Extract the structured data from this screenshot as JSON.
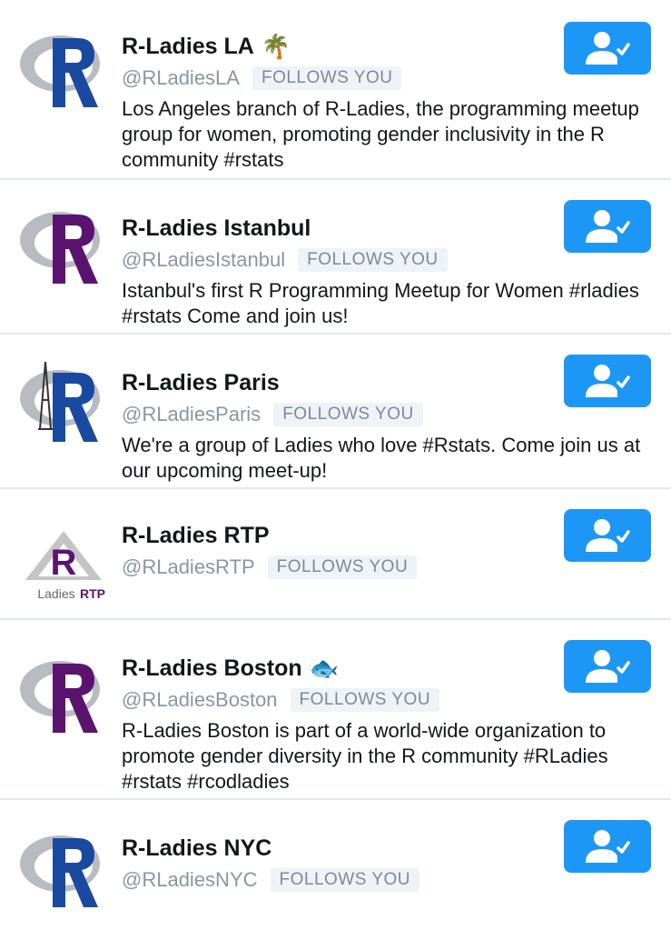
{
  "accounts": [
    {
      "name": "R-Ladies LA",
      "emoji": "🌴",
      "handle": "@RLadiesLA",
      "badge": "FOLLOWS YOU",
      "bio": "Los Angeles branch of R-Ladies, the programming meetup group for women, promoting gender inclusivity in the R community #rstats",
      "avatar_color": "#1a4aa0"
    },
    {
      "name": "R-Ladies Istanbul",
      "emoji": "",
      "handle": "@RLadiesIstanbul",
      "badge": "FOLLOWS YOU",
      "bio": "Istanbul's first R Programming Meetup for Women #rladies #rstats Come and join us!",
      "avatar_color": "#5a1470"
    },
    {
      "name": "R-Ladies Paris",
      "emoji": "",
      "handle": "@RLadiesParis",
      "badge": "FOLLOWS YOU",
      "bio": "We're a group of Ladies who love #Rstats. Come join us at our upcoming meet-up!",
      "avatar_color": "#1a4aa0"
    },
    {
      "name": "R-Ladies RTP",
      "emoji": "",
      "handle": "@RLadiesRTP",
      "badge": "FOLLOWS YOU",
      "bio": "",
      "avatar_color": "#5a1470",
      "avatar_text": "Ladies RTP"
    },
    {
      "name": "R-Ladies Boston",
      "emoji": "🐟",
      "handle": "@RLadiesBoston",
      "badge": "FOLLOWS YOU",
      "bio": "R-Ladies Boston is part of a world-wide organization to promote gender diversity in the R community #RLadies #rstats #rcodladies",
      "avatar_color": "#5a1470"
    },
    {
      "name": "R-Ladies NYC",
      "emoji": "",
      "handle": "@RLadiesNYC",
      "badge": "FOLLOWS YOU",
      "bio": "",
      "avatar_color": "#1a4aa0"
    }
  ],
  "colors": {
    "follow_button": "#1d97f5",
    "handle_text": "#8a97a3",
    "badge_bg": "#eef3f7"
  },
  "icons": {
    "follow_button": "user-check-icon"
  }
}
